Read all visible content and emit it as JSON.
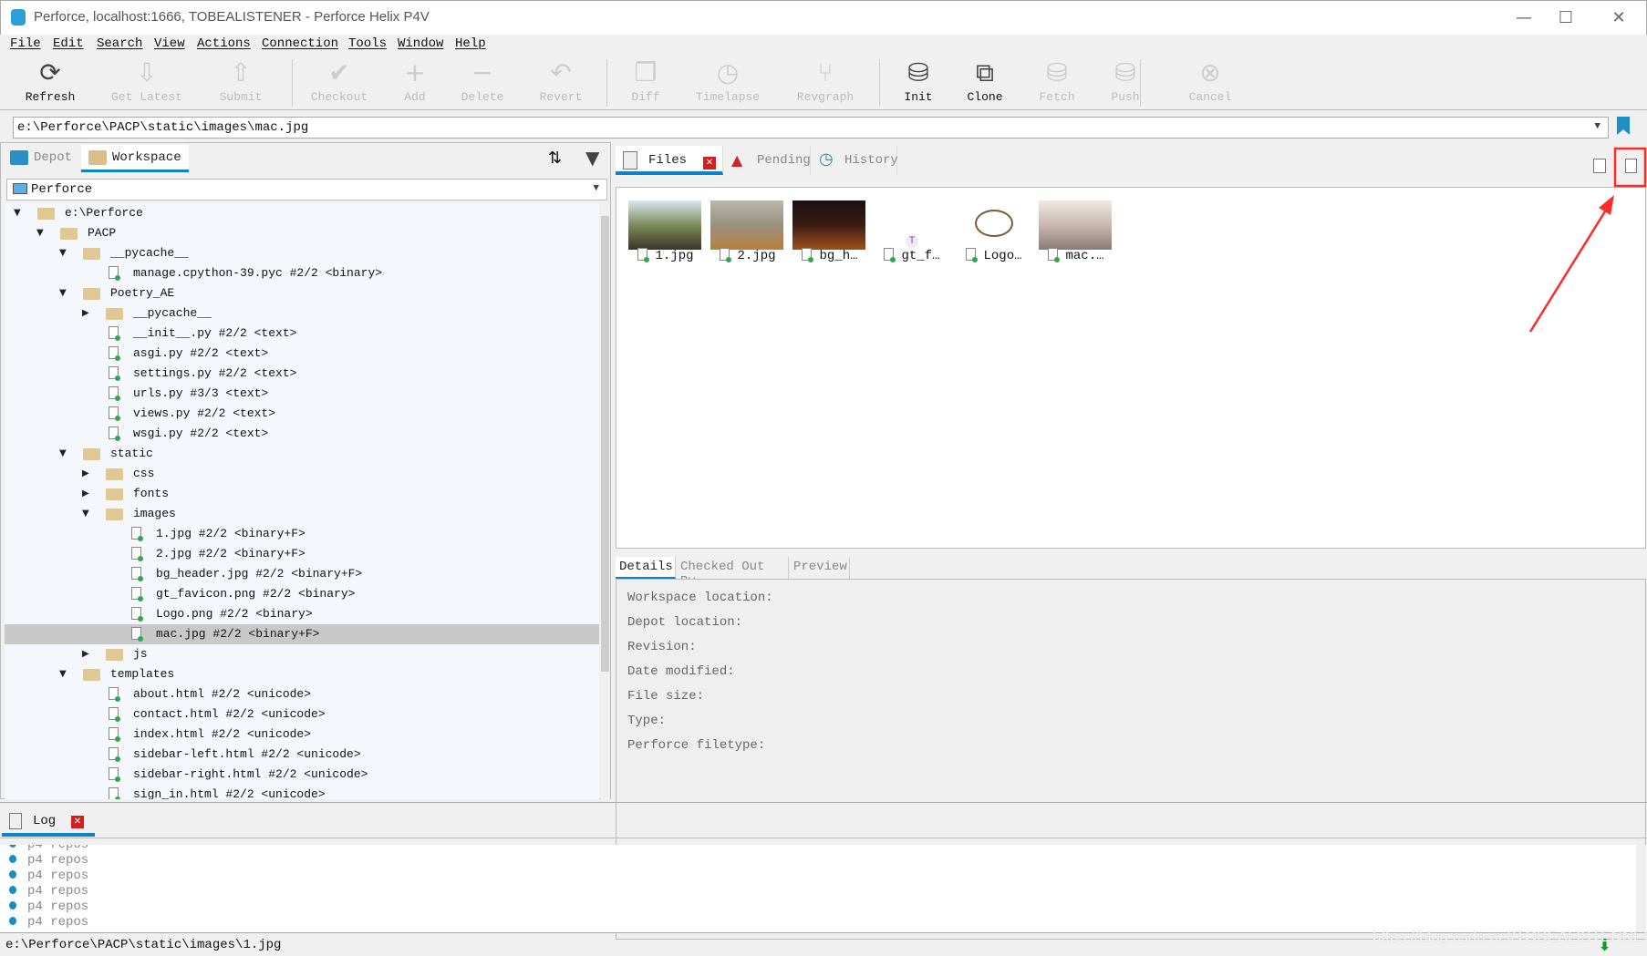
{
  "window": {
    "title": "Perforce,  localhost:1666,  TOBEALISTENER - Perforce Helix P4V",
    "minimize": "—",
    "maximize": "☐",
    "close": "✕"
  },
  "menu": [
    "File",
    "Edit",
    "Search",
    "View",
    "Actions",
    "Connection",
    "Tools",
    "Window",
    "Help"
  ],
  "toolbar": [
    {
      "label": "Refresh",
      "icon": "refresh-icon",
      "glyph": "⟳",
      "enabled": true
    },
    {
      "label": "Get Latest",
      "icon": "get-latest-icon",
      "glyph": "⇩",
      "enabled": false
    },
    {
      "label": "Submit",
      "icon": "submit-icon",
      "glyph": "⇧",
      "enabled": false
    },
    {
      "label": "Checkout",
      "icon": "checkmark-icon",
      "glyph": "✔",
      "enabled": false
    },
    {
      "label": "Add",
      "icon": "plus-icon",
      "glyph": "+",
      "enabled": false
    },
    {
      "label": "Delete",
      "icon": "minus-icon",
      "glyph": "−",
      "enabled": false
    },
    {
      "label": "Revert",
      "icon": "undo-icon",
      "glyph": "↶",
      "enabled": false
    },
    {
      "label": "Diff",
      "icon": "diff-icon",
      "glyph": "❐",
      "enabled": false
    },
    {
      "label": "Timelapse",
      "icon": "clock-icon",
      "glyph": "◷",
      "enabled": false
    },
    {
      "label": "Revgraph",
      "icon": "revgraph-icon",
      "glyph": "⑂",
      "enabled": false
    },
    {
      "label": "Init",
      "icon": "database-power-icon",
      "glyph": "⛁",
      "enabled": true
    },
    {
      "label": "Clone",
      "icon": "clone-icon",
      "glyph": "⧉",
      "enabled": true
    },
    {
      "label": "Fetch",
      "icon": "fetch-icon",
      "glyph": "⛁",
      "enabled": false
    },
    {
      "label": "Push",
      "icon": "push-icon",
      "glyph": "⛁",
      "enabled": false
    },
    {
      "label": "Cancel",
      "icon": "cancel-icon",
      "glyph": "⊗",
      "enabled": false
    }
  ],
  "address": {
    "value": "e:\\Perforce\\PACP\\static\\images\\mac.jpg"
  },
  "left": {
    "tabs": [
      "Depot",
      "Workspace"
    ],
    "active_tab": "Workspace",
    "workspace_select": "Perforce",
    "tree": [
      {
        "level": 0,
        "type": "folder",
        "open": true,
        "text": "e:\\Perforce"
      },
      {
        "level": 1,
        "type": "folder",
        "open": true,
        "text": "PACP"
      },
      {
        "level": 2,
        "type": "folder",
        "open": true,
        "text": "__pycache__"
      },
      {
        "level": 3,
        "type": "file",
        "text": "manage.cpython-39.pyc #2/2 <binary>"
      },
      {
        "level": 2,
        "type": "folder",
        "open": true,
        "text": "Poetry_AE"
      },
      {
        "level": 3,
        "type": "folder",
        "open": false,
        "text": "__pycache__"
      },
      {
        "level": 3,
        "type": "file",
        "text": "__init__.py #2/2 <text>"
      },
      {
        "level": 3,
        "type": "file",
        "text": "asgi.py #2/2 <text>"
      },
      {
        "level": 3,
        "type": "file",
        "text": "settings.py #2/2 <text>"
      },
      {
        "level": 3,
        "type": "file",
        "text": "urls.py #3/3 <text>"
      },
      {
        "level": 3,
        "type": "file",
        "text": "views.py #2/2 <text>"
      },
      {
        "level": 3,
        "type": "file",
        "text": "wsgi.py #2/2 <text>"
      },
      {
        "level": 2,
        "type": "folder",
        "open": true,
        "text": "static"
      },
      {
        "level": 3,
        "type": "folder",
        "open": false,
        "text": "css"
      },
      {
        "level": 3,
        "type": "folder",
        "open": false,
        "text": "fonts"
      },
      {
        "level": 3,
        "type": "folder",
        "open": true,
        "text": "images"
      },
      {
        "level": 4,
        "type": "file",
        "text": "1.jpg #2/2 <binary+F>"
      },
      {
        "level": 4,
        "type": "file",
        "text": "2.jpg #2/2 <binary+F>"
      },
      {
        "level": 4,
        "type": "file",
        "text": "bg_header.jpg #2/2 <binary+F>"
      },
      {
        "level": 4,
        "type": "file",
        "text": "gt_favicon.png #2/2 <binary>"
      },
      {
        "level": 4,
        "type": "file",
        "text": "Logo.png #2/2 <binary>"
      },
      {
        "level": 4,
        "type": "file",
        "text": "mac.jpg #2/2 <binary+F>",
        "selected": true
      },
      {
        "level": 3,
        "type": "folder",
        "open": false,
        "text": "js"
      },
      {
        "level": 2,
        "type": "folder",
        "open": true,
        "text": "templates"
      },
      {
        "level": 3,
        "type": "file",
        "text": "about.html #2/2 <unicode>"
      },
      {
        "level": 3,
        "type": "file",
        "text": "contact.html #2/2 <unicode>"
      },
      {
        "level": 3,
        "type": "file",
        "text": "index.html #2/2 <unicode>"
      },
      {
        "level": 3,
        "type": "file",
        "text": "sidebar-left.html #2/2 <unicode>"
      },
      {
        "level": 3,
        "type": "file",
        "text": "sidebar-right.html #2/2 <unicode>"
      },
      {
        "level": 3,
        "type": "file",
        "text": "sign_in.html #2/2 <unicode>"
      }
    ]
  },
  "right": {
    "tabs": [
      "Files",
      "Pending",
      "History"
    ],
    "active_tab": "Files",
    "files": [
      {
        "name": "1.jpg",
        "colors": [
          "#d8e8f0",
          "#7d8a5a",
          "#3a3428"
        ]
      },
      {
        "name": "2.jpg",
        "colors": [
          "#b8b8aa",
          "#9a9080",
          "#b8803a"
        ]
      },
      {
        "name": "bg_h…",
        "colors": [
          "#1a1014",
          "#3a1c14",
          "#a0501c"
        ]
      },
      {
        "name": "gt_f…",
        "colors": []
      },
      {
        "name": "Logo…",
        "colors": []
      },
      {
        "name": "mac.…",
        "colors": [
          "#f0e8e4",
          "#c8b8b0",
          "#8a7a74"
        ]
      }
    ],
    "favicon_letter": "T",
    "detail_tabs": [
      "Details",
      "Checked Out By",
      "Preview"
    ],
    "details": [
      "Workspace location:",
      "Depot location:",
      "Revision:",
      "Date modified:",
      "File size:",
      "Type:",
      "Perforce filetype:"
    ]
  },
  "log": {
    "tab": "Log",
    "lines": [
      "p4 repos",
      "p4 repos",
      "p4 repos",
      "p4 repos",
      "p4 repos",
      "p4 repos"
    ]
  },
  "status": {
    "text": "e:\\Perforce\\PACP\\static\\images\\1.jpg"
  },
  "watermark": "https://blog.csdn.net/TOBEALISTENNER",
  "colors": {
    "accent": "#0a84c6",
    "annotation": "#ff2a2a",
    "selection": "#c8c8c8"
  }
}
